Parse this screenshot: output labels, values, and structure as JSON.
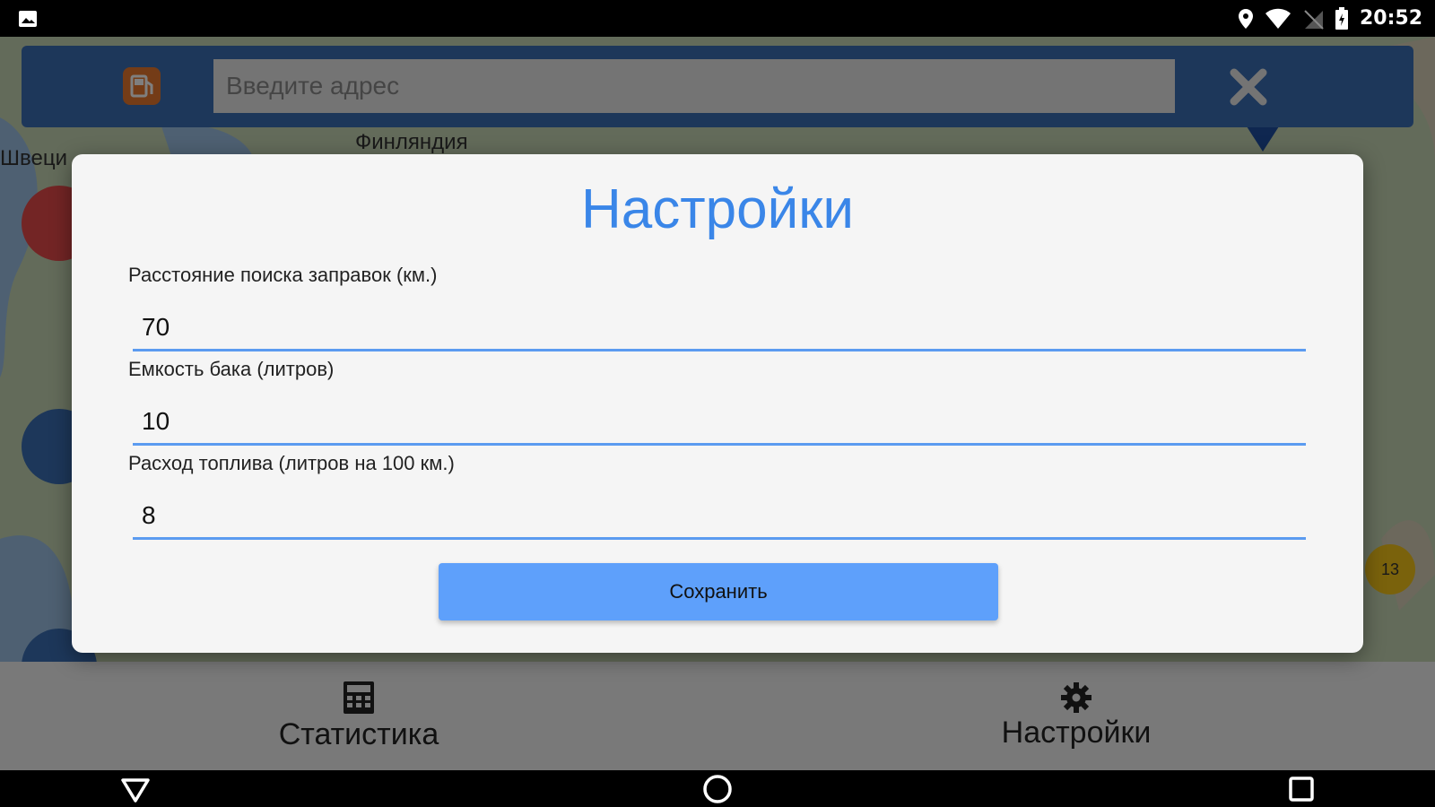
{
  "status_bar": {
    "time": "20:52",
    "icons": [
      "image-icon",
      "location-icon",
      "wifi-icon",
      "no-sim-icon",
      "battery-icon"
    ]
  },
  "search": {
    "placeholder": "Введите адрес",
    "value": ""
  },
  "map": {
    "labels": [
      "Финляндия",
      "Швеци"
    ],
    "cluster_count": "13"
  },
  "dialog": {
    "title": "Настройки",
    "fields": [
      {
        "label": "Расстояние поиска заправок (км.)",
        "value": "70"
      },
      {
        "label": "Емкость бака (литров)",
        "value": "10"
      },
      {
        "label": "Расход топлива (литров на 100 км.)",
        "value": "8"
      }
    ],
    "save_label": "Сохранить"
  },
  "bottom_nav": {
    "items": [
      {
        "label": "Статистика",
        "icon": "calculator-icon"
      },
      {
        "label": "Настройки",
        "icon": "gear-icon"
      }
    ]
  },
  "system_nav": [
    "back-icon",
    "home-icon",
    "recents-icon"
  ],
  "colors": {
    "accent": "#3a86e8",
    "button": "#5ea0fb",
    "search_bar": "#3b6eb4"
  }
}
